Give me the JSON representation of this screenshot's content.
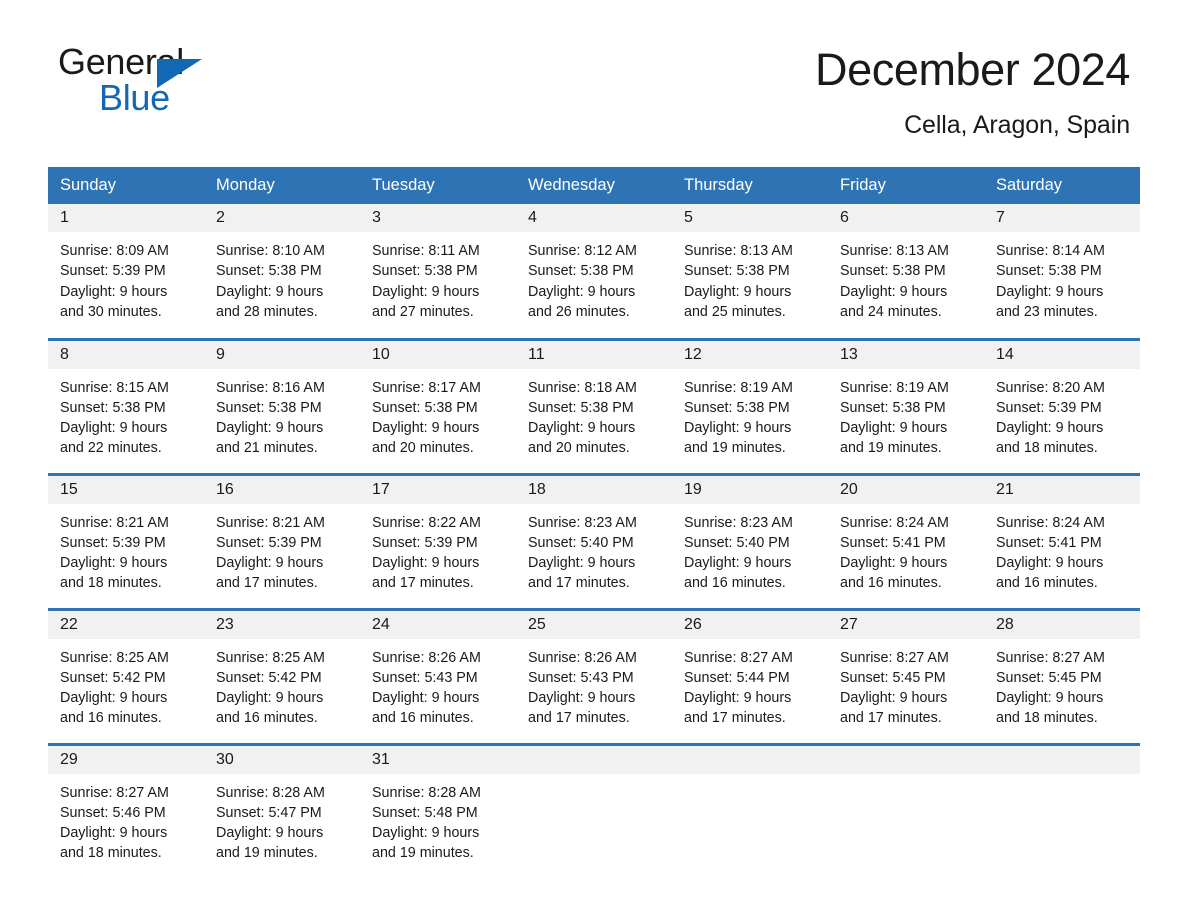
{
  "logo": {
    "word_one": "General",
    "word_two": "Blue",
    "triangle_icon": "triangle-icon",
    "brand_blue": "#1268b3"
  },
  "header": {
    "title": "December 2024",
    "location": "Cella, Aragon, Spain"
  },
  "theme": {
    "header_blue": "#2e74b5",
    "daynum_band": "#f1f1f1",
    "text": "#1a1a1a",
    "page_background": "#ffffff"
  },
  "calendar": {
    "weekday_headers": [
      "Sunday",
      "Monday",
      "Tuesday",
      "Wednesday",
      "Thursday",
      "Friday",
      "Saturday"
    ],
    "weeks": [
      [
        {
          "day": "1",
          "info": "Sunrise: 8:09 AM\nSunset: 5:39 PM\nDaylight: 9 hours and 30 minutes."
        },
        {
          "day": "2",
          "info": "Sunrise: 8:10 AM\nSunset: 5:38 PM\nDaylight: 9 hours and 28 minutes."
        },
        {
          "day": "3",
          "info": "Sunrise: 8:11 AM\nSunset: 5:38 PM\nDaylight: 9 hours and 27 minutes."
        },
        {
          "day": "4",
          "info": "Sunrise: 8:12 AM\nSunset: 5:38 PM\nDaylight: 9 hours and 26 minutes."
        },
        {
          "day": "5",
          "info": "Sunrise: 8:13 AM\nSunset: 5:38 PM\nDaylight: 9 hours and 25 minutes."
        },
        {
          "day": "6",
          "info": "Sunrise: 8:13 AM\nSunset: 5:38 PM\nDaylight: 9 hours and 24 minutes."
        },
        {
          "day": "7",
          "info": "Sunrise: 8:14 AM\nSunset: 5:38 PM\nDaylight: 9 hours and 23 minutes."
        }
      ],
      [
        {
          "day": "8",
          "info": "Sunrise: 8:15 AM\nSunset: 5:38 PM\nDaylight: 9 hours and 22 minutes."
        },
        {
          "day": "9",
          "info": "Sunrise: 8:16 AM\nSunset: 5:38 PM\nDaylight: 9 hours and 21 minutes."
        },
        {
          "day": "10",
          "info": "Sunrise: 8:17 AM\nSunset: 5:38 PM\nDaylight: 9 hours and 20 minutes."
        },
        {
          "day": "11",
          "info": "Sunrise: 8:18 AM\nSunset: 5:38 PM\nDaylight: 9 hours and 20 minutes."
        },
        {
          "day": "12",
          "info": "Sunrise: 8:19 AM\nSunset: 5:38 PM\nDaylight: 9 hours and 19 minutes."
        },
        {
          "day": "13",
          "info": "Sunrise: 8:19 AM\nSunset: 5:38 PM\nDaylight: 9 hours and 19 minutes."
        },
        {
          "day": "14",
          "info": "Sunrise: 8:20 AM\nSunset: 5:39 PM\nDaylight: 9 hours and 18 minutes."
        }
      ],
      [
        {
          "day": "15",
          "info": "Sunrise: 8:21 AM\nSunset: 5:39 PM\nDaylight: 9 hours and 18 minutes."
        },
        {
          "day": "16",
          "info": "Sunrise: 8:21 AM\nSunset: 5:39 PM\nDaylight: 9 hours and 17 minutes."
        },
        {
          "day": "17",
          "info": "Sunrise: 8:22 AM\nSunset: 5:39 PM\nDaylight: 9 hours and 17 minutes."
        },
        {
          "day": "18",
          "info": "Sunrise: 8:23 AM\nSunset: 5:40 PM\nDaylight: 9 hours and 17 minutes."
        },
        {
          "day": "19",
          "info": "Sunrise: 8:23 AM\nSunset: 5:40 PM\nDaylight: 9 hours and 16 minutes."
        },
        {
          "day": "20",
          "info": "Sunrise: 8:24 AM\nSunset: 5:41 PM\nDaylight: 9 hours and 16 minutes."
        },
        {
          "day": "21",
          "info": "Sunrise: 8:24 AM\nSunset: 5:41 PM\nDaylight: 9 hours and 16 minutes."
        }
      ],
      [
        {
          "day": "22",
          "info": "Sunrise: 8:25 AM\nSunset: 5:42 PM\nDaylight: 9 hours and 16 minutes."
        },
        {
          "day": "23",
          "info": "Sunrise: 8:25 AM\nSunset: 5:42 PM\nDaylight: 9 hours and 16 minutes."
        },
        {
          "day": "24",
          "info": "Sunrise: 8:26 AM\nSunset: 5:43 PM\nDaylight: 9 hours and 16 minutes."
        },
        {
          "day": "25",
          "info": "Sunrise: 8:26 AM\nSunset: 5:43 PM\nDaylight: 9 hours and 17 minutes."
        },
        {
          "day": "26",
          "info": "Sunrise: 8:27 AM\nSunset: 5:44 PM\nDaylight: 9 hours and 17 minutes."
        },
        {
          "day": "27",
          "info": "Sunrise: 8:27 AM\nSunset: 5:45 PM\nDaylight: 9 hours and 17 minutes."
        },
        {
          "day": "28",
          "info": "Sunrise: 8:27 AM\nSunset: 5:45 PM\nDaylight: 9 hours and 18 minutes."
        }
      ],
      [
        {
          "day": "29",
          "info": "Sunrise: 8:27 AM\nSunset: 5:46 PM\nDaylight: 9 hours and 18 minutes."
        },
        {
          "day": "30",
          "info": "Sunrise: 8:28 AM\nSunset: 5:47 PM\nDaylight: 9 hours and 19 minutes."
        },
        {
          "day": "31",
          "info": "Sunrise: 8:28 AM\nSunset: 5:48 PM\nDaylight: 9 hours and 19 minutes."
        },
        {
          "day": "",
          "info": ""
        },
        {
          "day": "",
          "info": ""
        },
        {
          "day": "",
          "info": ""
        },
        {
          "day": "",
          "info": ""
        }
      ]
    ]
  }
}
